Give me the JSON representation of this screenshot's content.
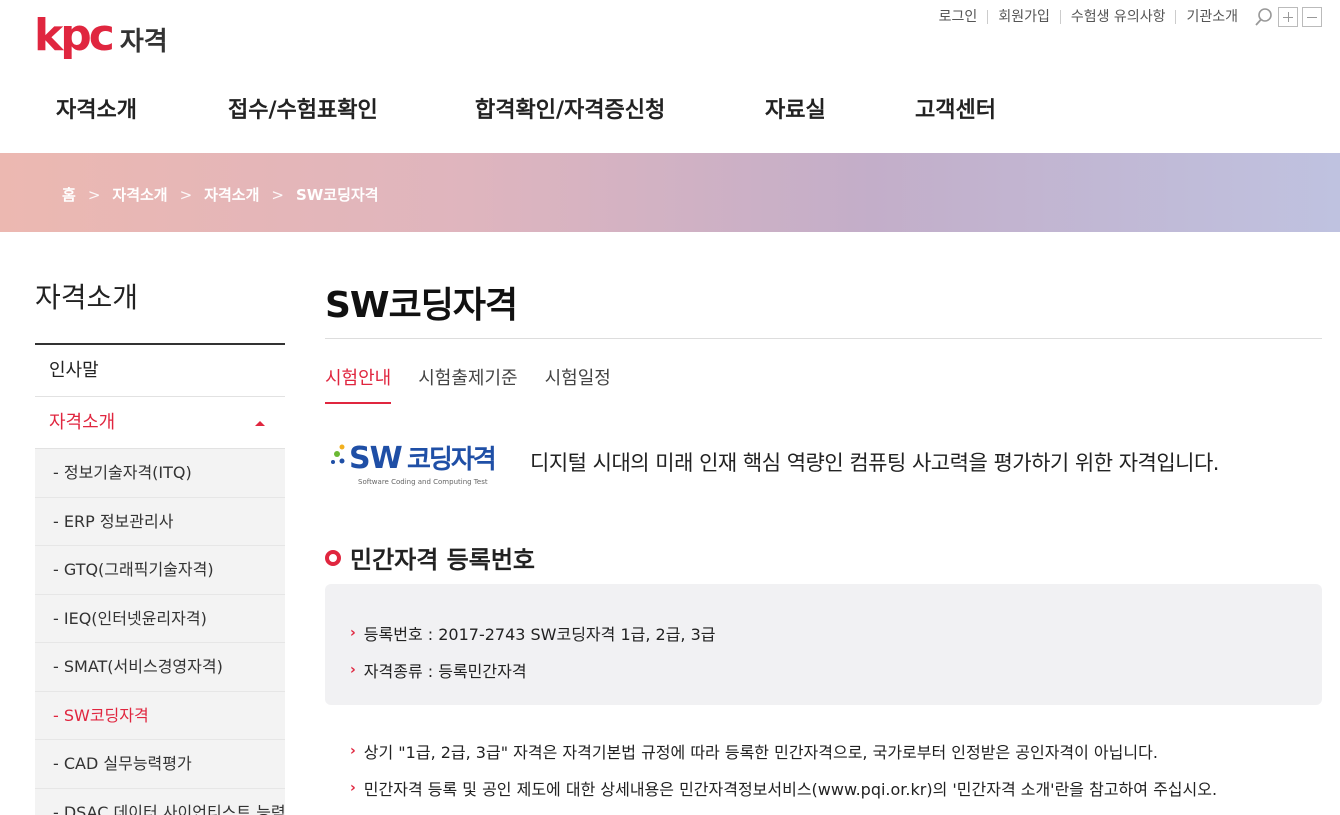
{
  "header": {
    "logo_main": "kpc",
    "logo_sub": "자격",
    "util_links": [
      "로그인",
      "회원가입",
      "수험생 유의사항",
      "기관소개"
    ],
    "util_icons": [
      "search-icon",
      "zoom-in-icon",
      "zoom-out-icon"
    ],
    "gnb": [
      "자격소개",
      "접수/수험표확인",
      "합격확인/자격증신청",
      "자료실",
      "고객센터"
    ]
  },
  "breadcrumb": [
    "홈",
    "자격소개",
    "자격소개",
    "SW코딩자격"
  ],
  "sidebar": {
    "title": "자격소개",
    "items": [
      {
        "label": "인사말"
      },
      {
        "label": "자격소개"
      }
    ],
    "sub_items": [
      "- 정보기술자격(ITQ)",
      "- ERP 정보관리사",
      "- GTQ(그래픽기술자격)",
      "- IEQ(인터넷윤리자격)",
      "- SMAT(서비스경영자격)",
      "- SW코딩자격",
      "- CAD 실무능력평가",
      "- DSAC 데이터 사이언티스트 능력인증자격"
    ]
  },
  "main": {
    "title": "SW코딩자격",
    "tabs": [
      "시험안내",
      "시험출제기준",
      "시험일정"
    ],
    "logo_text": "SW 코딩자격",
    "logo_caption": "Software Coding and Computing Test",
    "intro": "디지털 시대의 미래 인재 핵심 역량인 컴퓨팅 사고력을 평가하기 위한 자격입니다.",
    "section_title": "민간자격 등록번호",
    "info": [
      "등록번호 : 2017-2743 SW코딩자격 1급, 2급, 3급",
      "자격종류 : 등록민간자격"
    ],
    "notes": [
      "상기 \"1급, 2급, 3급\" 자격은 자격기본법 규정에 따라 등록한 민간자격으로, 국가로부터 인정받은 공인자격이 아닙니다.",
      "민간자격 등록 및 공인 제도에 대한 상세내용은 민간자격정보서비스(www.pqi.or.kr)의 '민간자격 소개'란을 참고하여 주십시오."
    ]
  },
  "colors": {
    "accent": "#e0263f",
    "banner_start": "#ecb8b1",
    "banner_end": "#bfc2e0",
    "sw_blue": "#1f4fa6",
    "sw_green": "#6bb933",
    "sw_yellow": "#f2b01e"
  }
}
